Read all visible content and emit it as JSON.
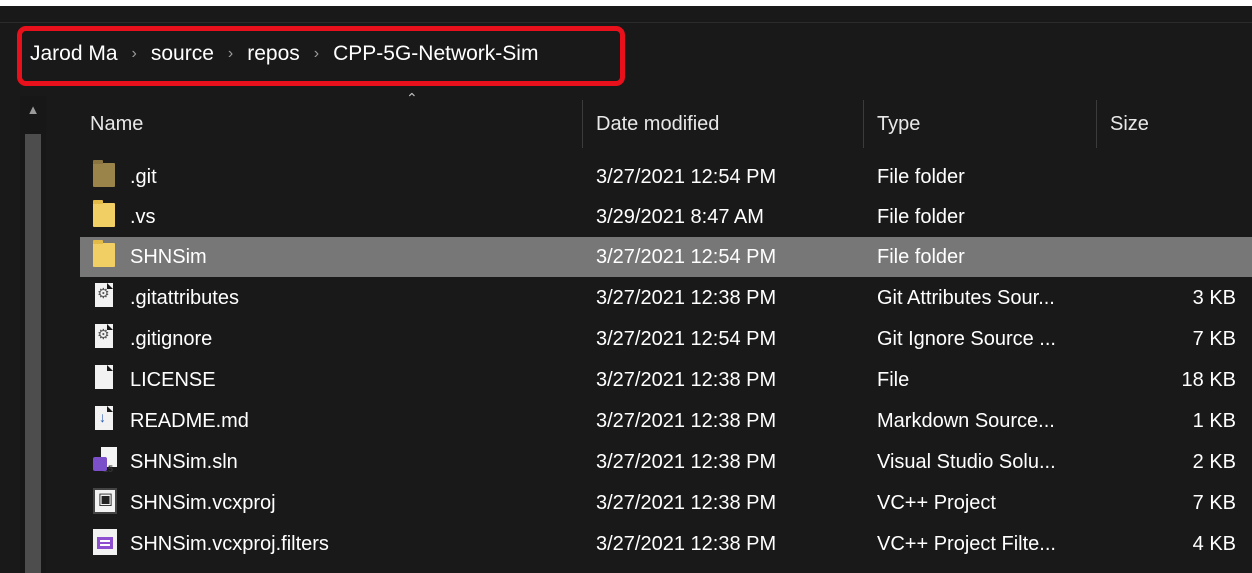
{
  "breadcrumb": {
    "items": [
      "Jarod Ma",
      "source",
      "repos",
      "CPP-5G-Network-Sim"
    ],
    "separator": "›",
    "highlight_color": "#e8101a"
  },
  "columns": {
    "name": "Name",
    "date": "Date modified",
    "type": "Type",
    "size": "Size",
    "sorted_by": "Name",
    "sort_direction": "ascending"
  },
  "files": [
    {
      "icon": "folder-icon",
      "name": ".git",
      "date": "3/27/2021 12:54 PM",
      "type": "File folder",
      "size": ""
    },
    {
      "icon": "folder-icon",
      "name": ".vs",
      "date": "3/29/2021 8:47 AM",
      "type": "File folder",
      "size": ""
    },
    {
      "icon": "folder-icon",
      "name": "SHNSim",
      "date": "3/27/2021 12:54 PM",
      "type": "File folder",
      "size": "",
      "selected": true
    },
    {
      "icon": "settings-file-icon",
      "name": ".gitattributes",
      "date": "3/27/2021 12:38 PM",
      "type": "Git Attributes Sour...",
      "size": "3 KB"
    },
    {
      "icon": "settings-file-icon",
      "name": ".gitignore",
      "date": "3/27/2021 12:54 PM",
      "type": "Git Ignore Source ...",
      "size": "7 KB"
    },
    {
      "icon": "blank-file-icon",
      "name": "LICENSE",
      "date": "3/27/2021 12:38 PM",
      "type": "File",
      "size": "18 KB"
    },
    {
      "icon": "markdown-file-icon",
      "name": "README.md",
      "date": "3/27/2021 12:38 PM",
      "type": "Markdown Source...",
      "size": "1 KB"
    },
    {
      "icon": "visual-studio-solution-icon",
      "name": "SHNSim.sln",
      "date": "3/27/2021 12:38 PM",
      "type": "Visual Studio Solu...",
      "size": "2 KB"
    },
    {
      "icon": "vcxproj-icon",
      "name": "SHNSim.vcxproj",
      "date": "3/27/2021 12:38 PM",
      "type": "VC++ Project",
      "size": "7 KB"
    },
    {
      "icon": "filters-file-icon",
      "name": "SHNSim.vcxproj.filters",
      "date": "3/27/2021 12:38 PM",
      "type": "VC++ Project Filte...",
      "size": "4 KB"
    }
  ]
}
